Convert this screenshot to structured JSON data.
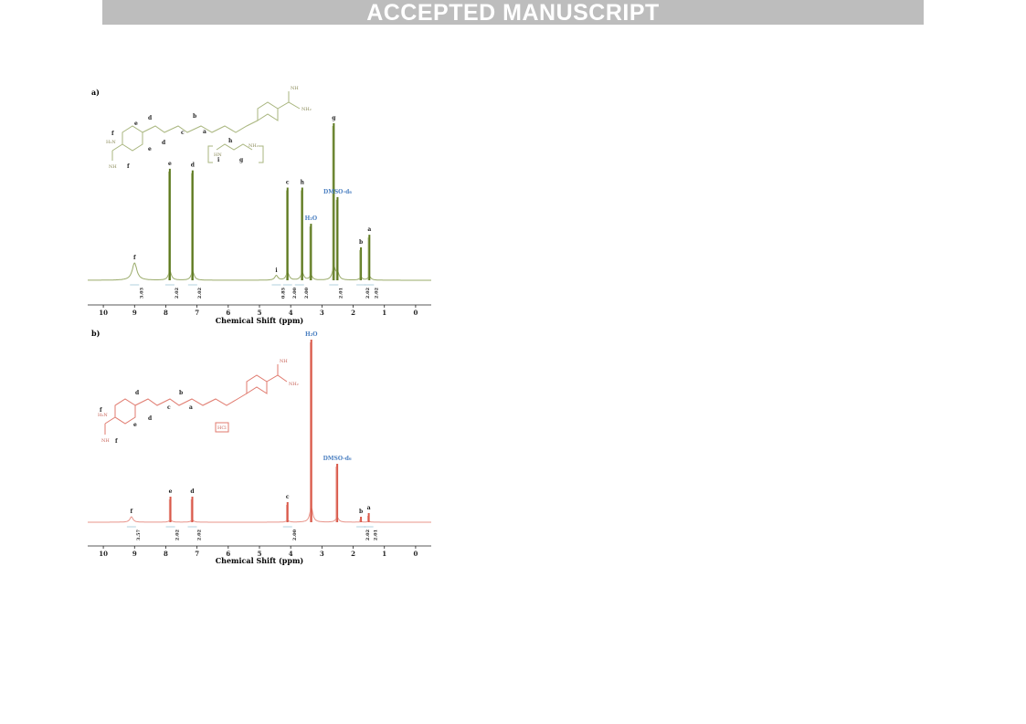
{
  "banner": {
    "text": "ACCEPTED MANUSCRIPT"
  },
  "chart_data": [
    {
      "type": "line",
      "panel_label": "a)",
      "xlabel": "Chemical Shift (ppm)",
      "ylabel": "",
      "xlim": [
        10.5,
        -0.5
      ],
      "x_reversed": true,
      "x_ticks": [
        10,
        9,
        8,
        7,
        6,
        5,
        4,
        3,
        2,
        1,
        0
      ],
      "color": "#9aab6a",
      "peak_color": "#5e7a20",
      "grid": false,
      "peaks": [
        {
          "x": 9.0,
          "height": 0.11,
          "width": 0.09,
          "label": "f"
        },
        {
          "x": 7.87,
          "height": 0.71,
          "width": 0.02,
          "label": "e"
        },
        {
          "x": 7.14,
          "height": 0.7,
          "width": 0.02,
          "label": "d"
        },
        {
          "x": 4.46,
          "height": 0.03,
          "width": 0.05,
          "label": "i"
        },
        {
          "x": 4.1,
          "height": 0.59,
          "width": 0.02,
          "label": "c"
        },
        {
          "x": 3.63,
          "height": 0.59,
          "width": 0.02,
          "label": "h"
        },
        {
          "x": 3.35,
          "height": 0.36,
          "width": 0.02,
          "label": "H₂O",
          "label_color": "#4a7fc1"
        },
        {
          "x": 2.62,
          "height": 1.0,
          "width": 0.015,
          "label": "g"
        },
        {
          "x": 2.5,
          "height": 0.53,
          "width": 0.02,
          "label": "DMSO-d₆",
          "label_color": "#4a7fc1"
        },
        {
          "x": 1.75,
          "height": 0.21,
          "width": 0.03,
          "label": "b"
        },
        {
          "x": 1.48,
          "height": 0.29,
          "width": 0.03,
          "label": "a"
        }
      ],
      "integrals": [
        {
          "x": 9.0,
          "value": "3.03"
        },
        {
          "x": 7.87,
          "value": "2.02"
        },
        {
          "x": 7.14,
          "value": "2.02"
        },
        {
          "x": 4.46,
          "value": "0.85"
        },
        {
          "x": 4.1,
          "value": "2.00"
        },
        {
          "x": 3.72,
          "value": "2.00"
        },
        {
          "x": 2.62,
          "value": "2.01"
        },
        {
          "x": 1.75,
          "value": "2.02"
        },
        {
          "x": 1.48,
          "value": "2.02"
        }
      ],
      "structure_labels": [
        "c",
        "d",
        "b",
        "a",
        "e",
        "f",
        "d",
        "e",
        "f",
        "h",
        "i",
        "g"
      ]
    },
    {
      "type": "line",
      "panel_label": "b)",
      "xlabel": "Chemical Shift (ppm)",
      "ylabel": "",
      "xlim": [
        10.5,
        -0.5
      ],
      "x_reversed": true,
      "x_ticks": [
        10,
        9,
        8,
        7,
        6,
        5,
        4,
        3,
        2,
        1,
        0
      ],
      "color": "#e8948a",
      "peak_color": "#d9594a",
      "grid": false,
      "peaks": [
        {
          "x": 9.1,
          "height": 0.03,
          "width": 0.05,
          "label": "f"
        },
        {
          "x": 7.85,
          "height": 0.14,
          "width": 0.02,
          "label": "e"
        },
        {
          "x": 7.15,
          "height": 0.14,
          "width": 0.02,
          "label": "d"
        },
        {
          "x": 4.1,
          "height": 0.11,
          "width": 0.02,
          "label": "c"
        },
        {
          "x": 3.34,
          "height": 1.0,
          "width": 0.012,
          "label": "H₂O",
          "label_color": "#4a7fc1"
        },
        {
          "x": 2.51,
          "height": 0.32,
          "width": 0.015,
          "label": "DMSO-d₆",
          "label_color": "#4a7fc1"
        },
        {
          "x": 1.75,
          "height": 0.03,
          "width": 0.03,
          "label": "b"
        },
        {
          "x": 1.5,
          "height": 0.05,
          "width": 0.03,
          "label": "a"
        }
      ],
      "integrals": [
        {
          "x": 9.1,
          "value": "3.57"
        },
        {
          "x": 7.85,
          "value": "2.02"
        },
        {
          "x": 7.15,
          "value": "2.02"
        },
        {
          "x": 4.1,
          "value": "2.00"
        },
        {
          "x": 1.75,
          "value": "2.02"
        },
        {
          "x": 1.5,
          "value": "2.01"
        }
      ],
      "structure_labels": [
        "d",
        "c",
        "b",
        "a",
        "f",
        "e",
        "d",
        "f"
      ]
    }
  ]
}
